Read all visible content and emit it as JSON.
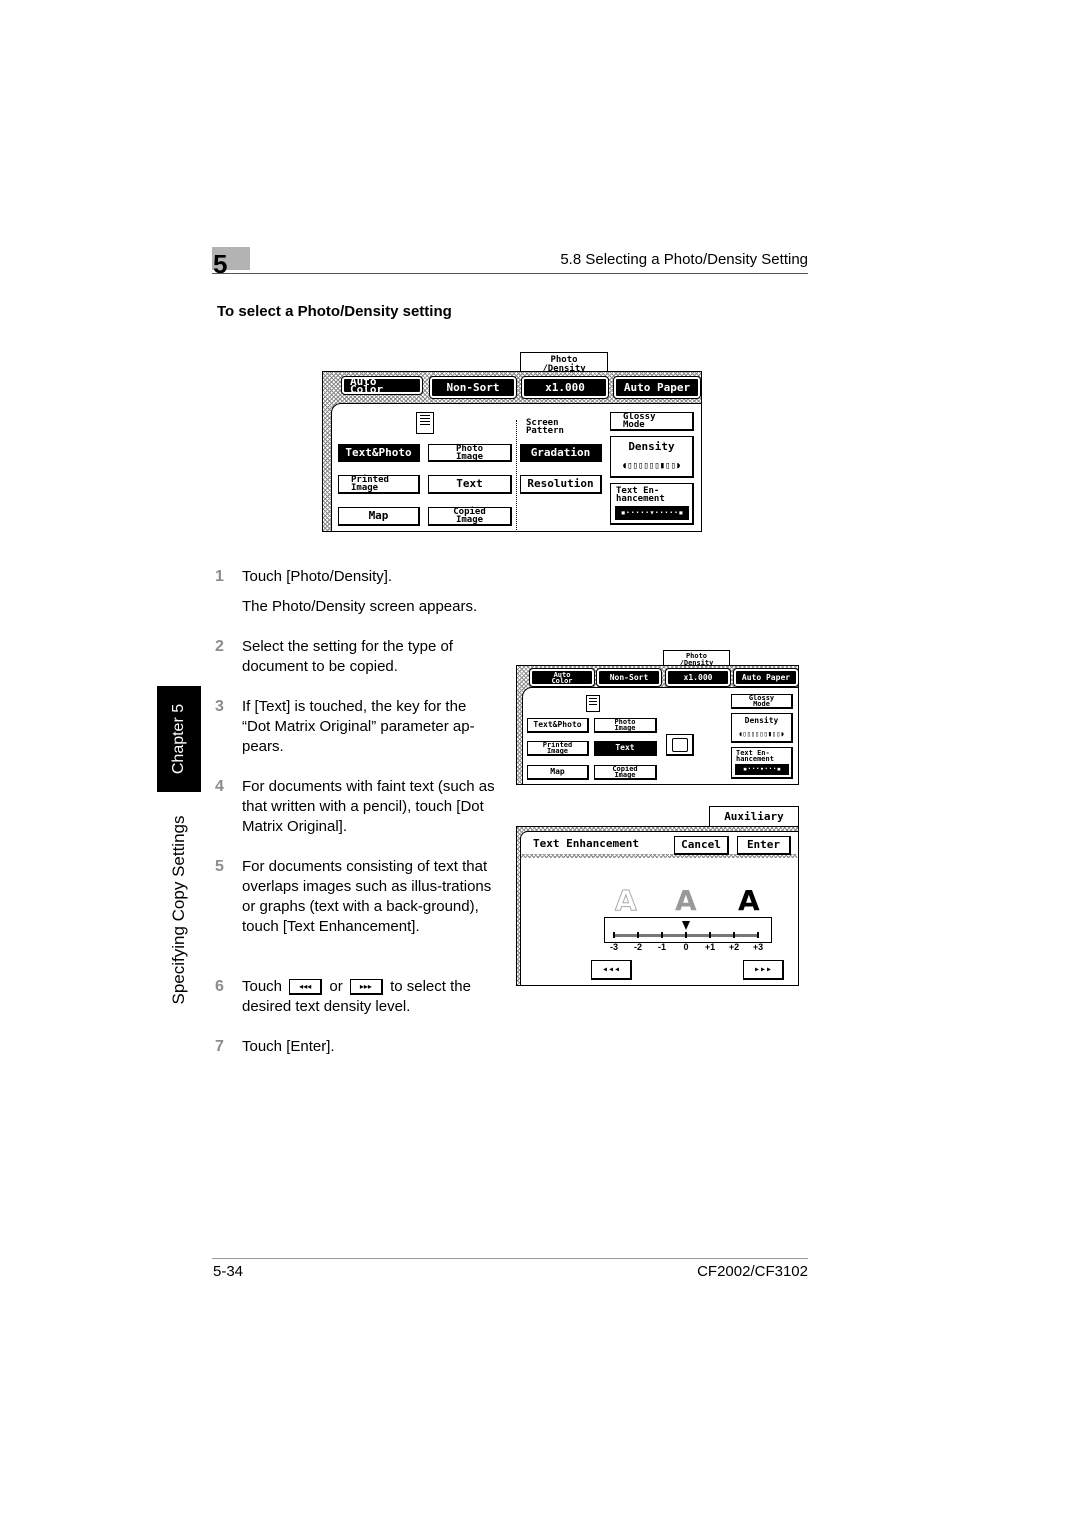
{
  "header": {
    "chapter_number": "5",
    "section_title": "5.8 Selecting a Photo/Density Setting"
  },
  "section_heading": "To select a Photo/Density setting",
  "side_tab": {
    "chapter_label": "Chapter 5",
    "title": "Specifying Copy Settings"
  },
  "screen1": {
    "tab_label_line1": "Photo",
    "tab_label_line2": "/Density",
    "top_buttons": [
      {
        "line1": "Auto",
        "line2": "Color"
      },
      {
        "line1": "Non-Sort",
        "line2": ""
      },
      {
        "line1": "x1.000",
        "line2": ""
      },
      {
        "line1": "Auto Paper",
        "line2": ""
      }
    ],
    "original_type_keys": [
      {
        "line1": "Text&Photo",
        "line2": "",
        "selected": true
      },
      {
        "line1": "Photo",
        "line2": "Image",
        "selected": false
      },
      {
        "line1": "Printed",
        "line2": "Image",
        "selected": false
      },
      {
        "line1": "Text",
        "line2": "",
        "selected": false
      },
      {
        "line1": "Map",
        "line2": "",
        "selected": false
      },
      {
        "line1": "Copied",
        "line2": "Image",
        "selected": false
      }
    ],
    "screen_pattern_label_line1": "Screen",
    "screen_pattern_label_line2": "Pattern",
    "gradation_label": "Gradation",
    "resolution_label": "Resolution",
    "glossy_line1": "Glossy",
    "glossy_line2": "Mode",
    "density_label": "Density",
    "density_bar": "◖▯▯▯▯▯▯▮▯▯◗",
    "text_enh_line1": "Text En-",
    "text_enh_line2": "hancement",
    "text_enh_bar": "▪·····▾·····▪"
  },
  "steps": [
    {
      "num": "1",
      "text": "Touch [Photo/Density]."
    },
    {
      "num": "",
      "text": "The Photo/Density screen appears."
    },
    {
      "num": "2",
      "text": "Select the setting for the type of document to be copied."
    },
    {
      "num": "3",
      "text": "If [Text] is touched, the key for the “Dot Matrix Original” parameter ap-pears."
    },
    {
      "num": "4",
      "text": "For documents with faint text (such as that written with a pencil), touch [Dot Matrix Original]."
    },
    {
      "num": "5",
      "text": "For documents consisting of text that overlaps images such as illus-trations or graphs (text with a back-ground), touch [Text Enhancement]."
    },
    {
      "num": "6",
      "text_before": "Touch",
      "text_mid": "or",
      "text_after": "to select the desired text density level."
    },
    {
      "num": "7",
      "text": "Touch [Enter]."
    }
  ],
  "step6_icons": {
    "left": "◂◂◂",
    "right": "▸▸▸"
  },
  "screen2": {
    "tab_label_line1": "Photo",
    "tab_label_line2": "/Density",
    "top_buttons": [
      {
        "line1": "Auto",
        "line2": "Color"
      },
      {
        "line1": "Non-Sort",
        "line2": ""
      },
      {
        "line1": "x1.000",
        "line2": ""
      },
      {
        "line1": "Auto Paper",
        "line2": ""
      }
    ],
    "keys": [
      {
        "line1": "Text&Photo",
        "line2": "",
        "selected": false
      },
      {
        "line1": "Photo",
        "line2": "Image",
        "selected": false
      },
      {
        "line1": "Printed",
        "line2": "Image",
        "selected": false
      },
      {
        "line1": "Text",
        "line2": "",
        "selected": true
      },
      {
        "line1": "Map",
        "line2": "",
        "selected": false
      },
      {
        "line1": "Copied",
        "line2": "Image",
        "selected": false
      }
    ],
    "dot_matrix_icon": "dot-matrix-printer-icon",
    "glossy_line1": "Glossy",
    "glossy_line2": "Mode",
    "density_label": "Density",
    "density_bar": "◖▯▯▯▯▯▯▮▯▯◗",
    "text_enh_line1": "Text En-",
    "text_enh_line2": "hancement",
    "text_enh_bar": "▪···▾···▪"
  },
  "screen3": {
    "tab_label": "Auxiliary",
    "title": "Text Enhancement",
    "cancel_label": "Cancel",
    "enter_label": "Enter",
    "sample_glyph": "A",
    "scale_labels": [
      "-3",
      "-2",
      "-1",
      "0",
      "+1",
      "+2",
      "+3"
    ],
    "current_level": "0",
    "left_button": "◂◂◂",
    "right_button": "▸▸▸"
  },
  "footer": {
    "page_number": "5-34",
    "model": "CF2002/CF3102"
  }
}
